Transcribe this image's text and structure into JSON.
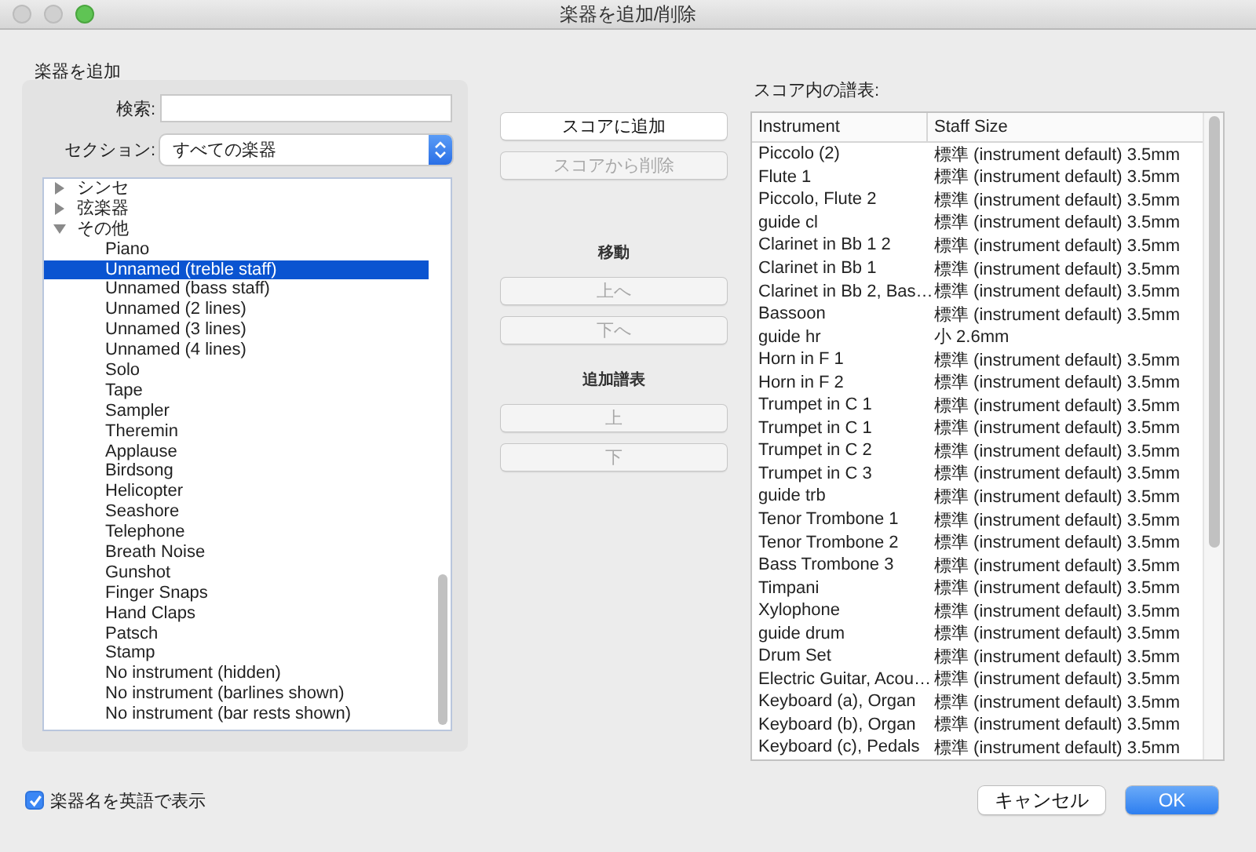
{
  "window": {
    "title": "楽器を追加/削除"
  },
  "add_panel": {
    "heading": "楽器を追加",
    "search": {
      "label": "検索:"
    },
    "section": {
      "label": "セクション:",
      "value": "すべての楽器"
    },
    "tree": [
      {
        "label": "シンセ",
        "expanded": false
      },
      {
        "label": "弦楽器",
        "expanded": false
      },
      {
        "label": "その他",
        "expanded": true,
        "children": [
          {
            "label": "Piano",
            "selected": false
          },
          {
            "label": "Unnamed (treble staff)",
            "selected": true
          },
          {
            "label": "Unnamed (bass staff)",
            "selected": false
          },
          {
            "label": "Unnamed (2 lines)",
            "selected": false
          },
          {
            "label": "Unnamed (3 lines)",
            "selected": false
          },
          {
            "label": "Unnamed (4 lines)",
            "selected": false
          },
          {
            "label": "Solo",
            "selected": false
          },
          {
            "label": "Tape",
            "selected": false
          },
          {
            "label": "Sampler",
            "selected": false
          },
          {
            "label": "Theremin",
            "selected": false
          },
          {
            "label": "Applause",
            "selected": false
          },
          {
            "label": "Birdsong",
            "selected": false
          },
          {
            "label": "Helicopter",
            "selected": false
          },
          {
            "label": "Seashore",
            "selected": false
          },
          {
            "label": "Telephone",
            "selected": false
          },
          {
            "label": "Breath Noise",
            "selected": false
          },
          {
            "label": "Gunshot",
            "selected": false
          },
          {
            "label": "Finger Snaps",
            "selected": false
          },
          {
            "label": "Hand Claps",
            "selected": false
          },
          {
            "label": "Patsch",
            "selected": false
          },
          {
            "label": "Stamp",
            "selected": false
          },
          {
            "label": "No instrument (hidden)",
            "selected": false
          },
          {
            "label": "No instrument (barlines shown)",
            "selected": false
          },
          {
            "label": "No instrument (bar rests shown)",
            "selected": false
          }
        ]
      }
    ]
  },
  "middle": [
    {
      "kind": "button",
      "label": "スコアに追加",
      "disabled": false
    },
    {
      "kind": "button",
      "label": "スコアから削除",
      "disabled": true
    },
    {
      "kind": "heading",
      "label": "移動"
    },
    {
      "kind": "button",
      "label": "上へ",
      "disabled": true
    },
    {
      "kind": "button",
      "label": "下へ",
      "disabled": true
    },
    {
      "kind": "heading",
      "label": "追加譜表"
    },
    {
      "kind": "button",
      "label": "上",
      "disabled": true
    },
    {
      "kind": "button",
      "label": "下",
      "disabled": true
    }
  ],
  "score_panel": {
    "heading": "スコア内の譜表:",
    "columns": [
      "Instrument",
      "Staff Size"
    ],
    "rows": [
      [
        "Piccolo (2)",
        "標準 (instrument default) 3.5mm"
      ],
      [
        "Flute  1",
        "標準 (instrument default) 3.5mm"
      ],
      [
        "Piccolo, Flute 2",
        "標準 (instrument default) 3.5mm"
      ],
      [
        "guide cl",
        "標準 (instrument default) 3.5mm"
      ],
      [
        "Clarinet in Bb 1 2",
        "標準 (instrument default) 3.5mm"
      ],
      [
        "Clarinet in Bb 1",
        "標準 (instrument default) 3.5mm"
      ],
      [
        "Clarinet in Bb 2, Bas…",
        "標準 (instrument default) 3.5mm"
      ],
      [
        "Bassoon",
        "標準 (instrument default) 3.5mm"
      ],
      [
        "guide hr",
        "小 2.6mm"
      ],
      [
        "Horn in F 1",
        "標準 (instrument default) 3.5mm"
      ],
      [
        "Horn in F 2",
        "標準 (instrument default) 3.5mm"
      ],
      [
        "Trumpet in C 1",
        "標準 (instrument default) 3.5mm"
      ],
      [
        "Trumpet in C 1",
        "標準 (instrument default) 3.5mm"
      ],
      [
        "Trumpet in C 2",
        "標準 (instrument default) 3.5mm"
      ],
      [
        "Trumpet in C 3",
        "標準 (instrument default) 3.5mm"
      ],
      [
        "guide trb",
        "標準 (instrument default) 3.5mm"
      ],
      [
        "Tenor Trombone 1",
        "標準 (instrument default) 3.5mm"
      ],
      [
        "Tenor Trombone 2",
        "標準 (instrument default) 3.5mm"
      ],
      [
        "Bass Trombone 3",
        "標準 (instrument default) 3.5mm"
      ],
      [
        "Timpani",
        "標準 (instrument default) 3.5mm"
      ],
      [
        "Xylophone",
        "標準 (instrument default) 3.5mm"
      ],
      [
        "guide drum",
        "標準 (instrument default) 3.5mm"
      ],
      [
        "Drum Set",
        "標準 (instrument default) 3.5mm"
      ],
      [
        "Electric Guitar, Acou…",
        "標準 (instrument default) 3.5mm"
      ],
      [
        "Keyboard (a), Organ",
        "標準 (instrument default) 3.5mm"
      ],
      [
        "Keyboard (b), Organ",
        "標準 (instrument default) 3.5mm"
      ],
      [
        "Keyboard (c), Pedals",
        "標準 (instrument default) 3.5mm"
      ]
    ]
  },
  "english_names": {
    "label": "楽器名を英語で表示",
    "checked": true
  },
  "footer_buttons": [
    {
      "label": "キャンセル",
      "default": false
    },
    {
      "label": "OK",
      "default": true
    }
  ]
}
